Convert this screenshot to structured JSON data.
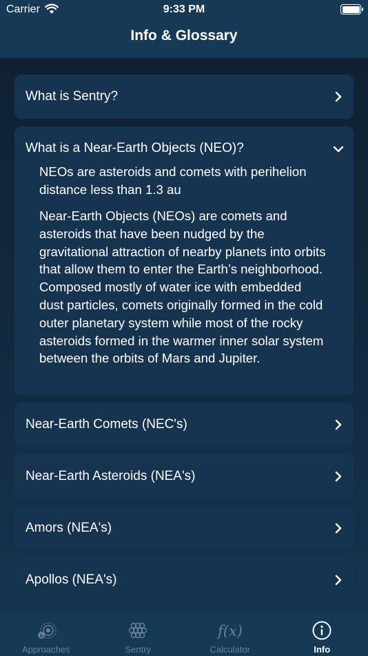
{
  "status_bar": {
    "carrier": "Carrier",
    "time": "9:33 PM",
    "wifi_icon": "wifi-icon",
    "battery_icon": "battery-icon"
  },
  "nav": {
    "title": "Info & Glossary"
  },
  "glossary": {
    "items": [
      {
        "label": "What is Sentry?",
        "expanded": false,
        "icon": "chevron-right-icon"
      },
      {
        "label": "What is a Near-Earth Objects (NEO)?",
        "expanded": true,
        "icon": "chevron-down-icon",
        "paragraphs": [
          "NEOs are asteroids and comets with perihelion distance less than 1.3 au",
          "Near-Earth Objects (NEOs) are comets and asteroids that have been nudged by the gravitational attraction of nearby planets into orbits that allow them to enter the Earth’s neighborhood. Composed mostly of water ice with embedded dust particles, comets originally formed in the cold outer planetary system while most of the rocky asteroids formed in the warmer inner solar system between the orbits of Mars and Jupiter."
        ]
      },
      {
        "label": "Near-Earth Comets (NEC's)",
        "expanded": false,
        "icon": "chevron-right-icon"
      },
      {
        "label": "Near-Earth Asteroids (NEA's)",
        "expanded": false,
        "icon": "chevron-right-icon"
      },
      {
        "label": "Amors (NEA's)",
        "expanded": false,
        "icon": "chevron-right-icon"
      },
      {
        "label": "Apollos (NEA's)",
        "expanded": false,
        "icon": "chevron-right-icon"
      }
    ]
  },
  "tab_bar": {
    "tabs": [
      {
        "label": "Approaches",
        "icon": "approaches-icon",
        "active": false
      },
      {
        "label": "Sentry",
        "icon": "sentry-icon",
        "active": false
      },
      {
        "label": "Calculator",
        "icon": "function-icon",
        "active": false
      },
      {
        "label": "Info",
        "icon": "info-icon",
        "active": true
      }
    ]
  },
  "colors": {
    "background": "#12283d",
    "bar": "#163a56",
    "card": "#163350",
    "tab_inactive": "#6b8196",
    "tab_active": "#ffffff"
  }
}
